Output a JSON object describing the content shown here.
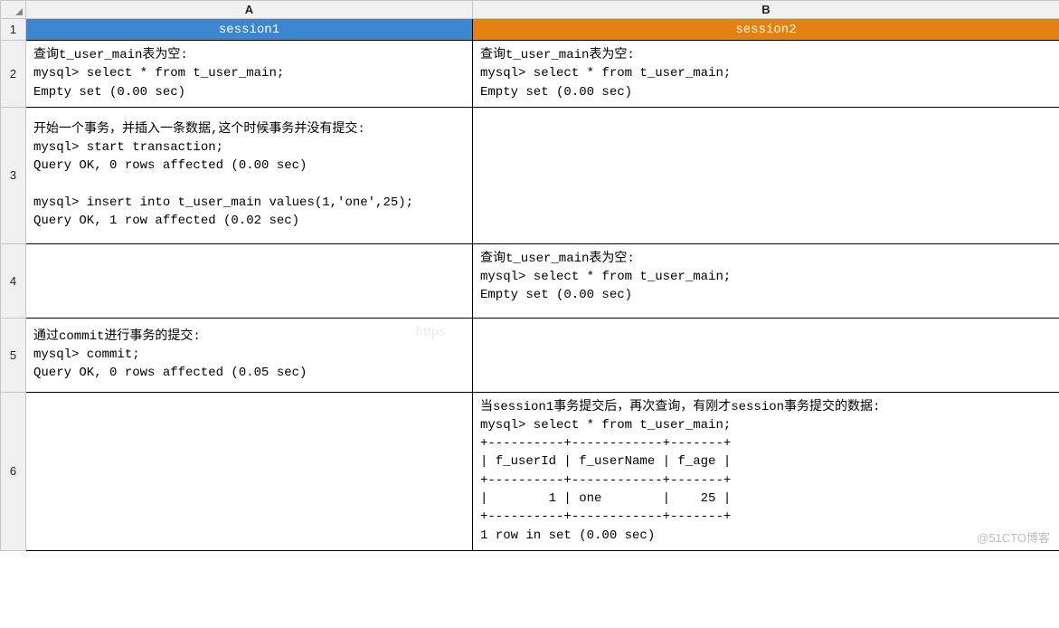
{
  "columns": {
    "A": "A",
    "B": "B"
  },
  "rows": {
    "r1": "1",
    "r2": "2",
    "r3": "3",
    "r4": "4",
    "r5": "5",
    "r6": "6"
  },
  "headers": {
    "session1": "session1",
    "session2": "session2"
  },
  "cells": {
    "r2a": "查询t_user_main表为空:\nmysql> select * from t_user_main;\nEmpty set (0.00 sec)",
    "r2b": "查询t_user_main表为空:\nmysql> select * from t_user_main;\nEmpty set (0.00 sec)",
    "r3a": "开始一个事务，并插入一条数据,这个时候事务并没有提交:\nmysql> start transaction;\nQuery OK, 0 rows affected (0.00 sec)\n\nmysql> insert into t_user_main values(1,'one',25);\nQuery OK, 1 row affected (0.02 sec)",
    "r3b": "",
    "r4a": "",
    "r4b": "查询t_user_main表为空:\nmysql> select * from t_user_main;\nEmpty set (0.00 sec)",
    "r5a": "通过commit进行事务的提交:\nmysql> commit;\nQuery OK, 0 rows affected (0.05 sec)",
    "r5b": "",
    "r6a": "",
    "r6b": "当session1事务提交后，再次查询，有刚才session事务提交的数据:\nmysql> select * from t_user_main;\n+----------+------------+-------+\n| f_userId | f_userName | f_age |\n+----------+------------+-------+\n|        1 | one        |    25 |\n+----------+------------+-------+\n1 row in set (0.00 sec)"
  },
  "watermark": "@51CTO博客",
  "watermark_center": "https"
}
